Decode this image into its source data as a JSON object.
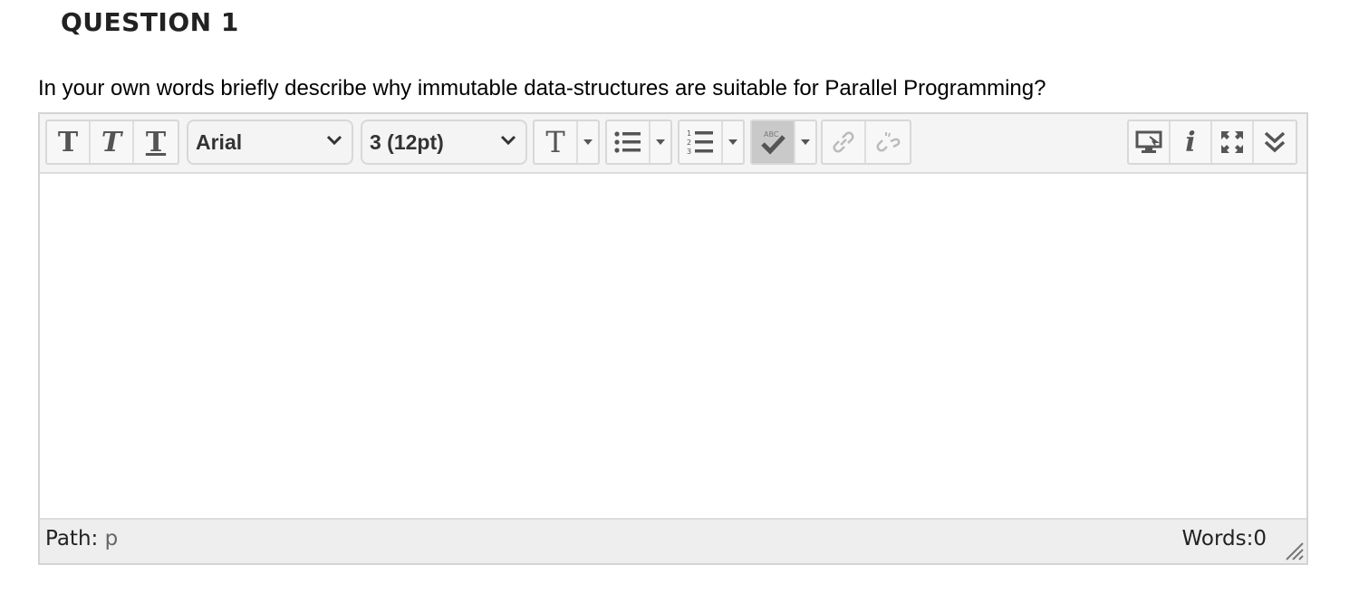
{
  "question": {
    "title": "QUESTION 1",
    "text": "In your own words briefly describe why immutable data-structures are suitable for Parallel Programming?"
  },
  "toolbar": {
    "bold_icon": "T",
    "italic_icon": "T",
    "underline_icon": "T",
    "font_family": "Arial",
    "font_size": "3 (12pt)",
    "text_color_icon": "T",
    "icons": [
      "bold-icon",
      "italic-icon",
      "underline-icon",
      "chevron-down-icon",
      "text-color-icon",
      "bullet-list-icon",
      "numbered-list-icon",
      "spellcheck-icon",
      "link-icon",
      "unlink-icon",
      "preview-icon",
      "info-icon",
      "fullscreen-icon",
      "more-icon"
    ],
    "spellcheck_label": "ABC"
  },
  "editor": {
    "content": ""
  },
  "status": {
    "path_label": "Path:",
    "path_value": "p",
    "words": "Words:0"
  },
  "colors": {
    "toolbar_bg": "#f4f4f4",
    "border": "#d4d4d4",
    "status_bg": "#eeeeee",
    "spellcheck_active": "#c9c9c9"
  }
}
